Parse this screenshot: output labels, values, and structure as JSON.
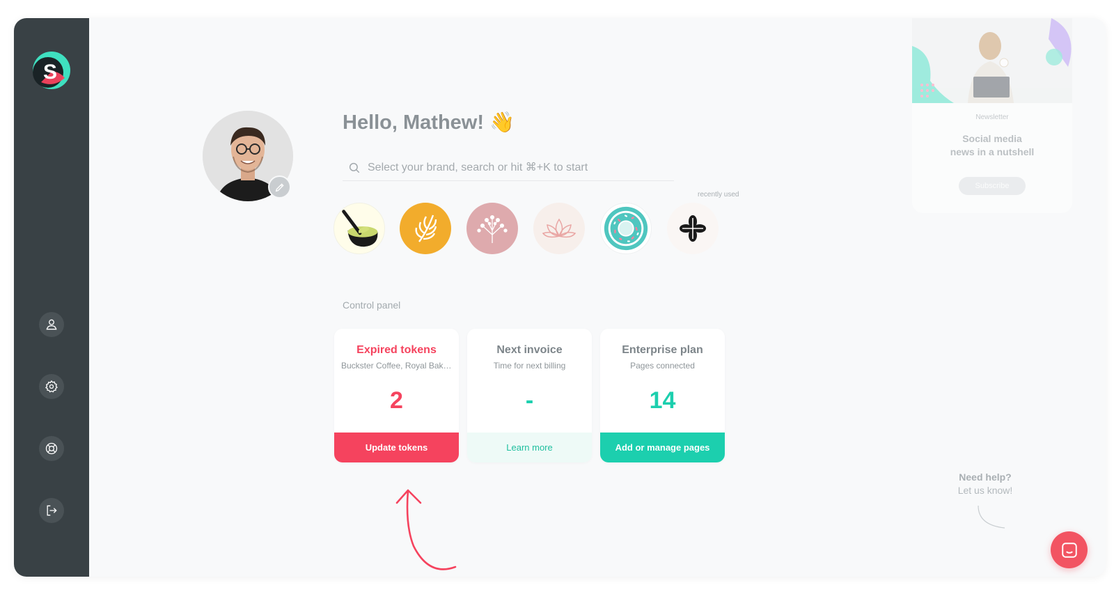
{
  "greeting": "Hello, Mathew! 👋",
  "search": {
    "placeholder": "Select your brand, search or hit ⌘+K to start"
  },
  "recently_used_label": "recently used",
  "control_panel_label": "Control panel",
  "cards": [
    {
      "title": "Expired tokens",
      "subtitle": "Buckster Coffee, Royal Bakery",
      "value": "2",
      "button": "Update tokens"
    },
    {
      "title": "Next invoice",
      "subtitle": "Time for next billing",
      "value": "-",
      "button": "Learn more"
    },
    {
      "title": "Enterprise plan",
      "subtitle": "Pages connected",
      "value": "14",
      "button": "Add or manage pages"
    }
  ],
  "newsletter": {
    "tag": "Newsletter",
    "title_line1": "Social media",
    "title_line2": "news in a nutshell",
    "button": "Subscribe"
  },
  "help": {
    "line1": "Need help?",
    "line2": "Let us know!"
  },
  "colors": {
    "sidebar": "#394145",
    "red": "#f5435e",
    "teal": "#1ccfae",
    "teal_light": "#eefaf7"
  },
  "brands": [
    "matcha-brand-icon",
    "latte-art-brand-icon",
    "floral-brand-icon",
    "lotus-brand-icon",
    "donut-brand-icon",
    "clover-brand-icon"
  ]
}
